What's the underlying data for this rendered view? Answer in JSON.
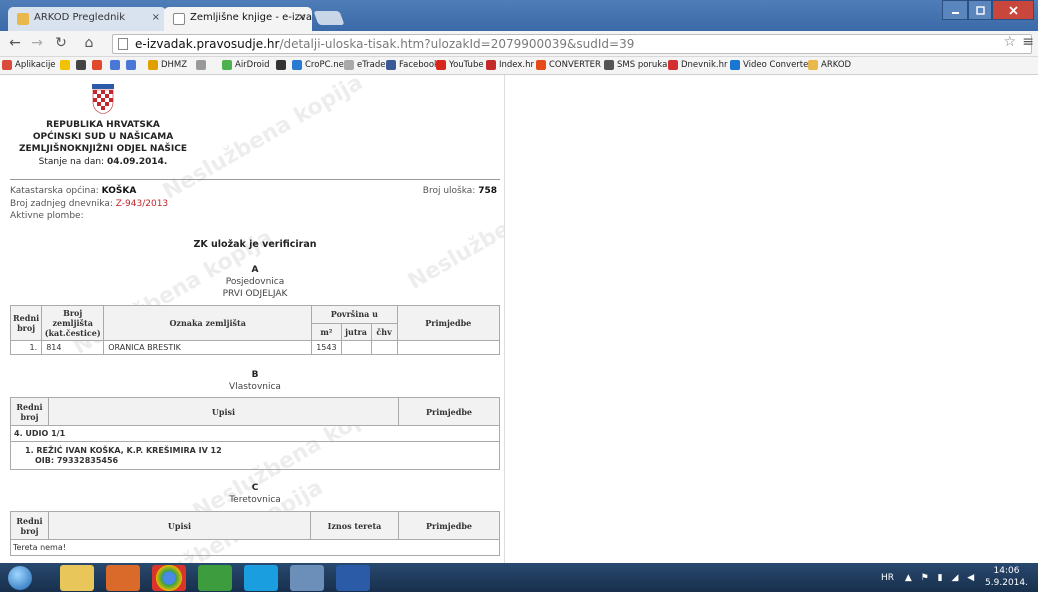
{
  "browser": {
    "tabs": [
      {
        "label": "ARKOD Preglednik"
      },
      {
        "label": "Zemljišne knjige - e-izvad"
      }
    ],
    "tab_close": "×",
    "url_host": "e-izvadak.pravosudje.hr",
    "url_path": "/detalji-uloska-tisak.htm?ulozakId=2079900039&sudId=39",
    "bookmarks": [
      {
        "label": "Aplikacije",
        "color": "#d94b3b"
      },
      {
        "label": "",
        "color": "#f2c200"
      },
      {
        "label": "",
        "color": "#444444"
      },
      {
        "label": "",
        "color": "#e04a2a"
      },
      {
        "label": "",
        "color": "#4a78d6"
      },
      {
        "label": "",
        "color": "#4a78d6"
      },
      {
        "label": "DHMZ",
        "color": "#e0a100"
      },
      {
        "label": "",
        "color": "#999999"
      },
      {
        "label": "AirDroid",
        "color": "#4db24d"
      },
      {
        "label": "",
        "color": "#333333"
      },
      {
        "label": "CroPC.net",
        "color": "#2a7ad1"
      },
      {
        "label": "eTrade",
        "color": "#aaaaaa"
      },
      {
        "label": "Facebook",
        "color": "#3b5998"
      },
      {
        "label": "YouTube",
        "color": "#d8261c"
      },
      {
        "label": "Index.hr",
        "color": "#c52a2a"
      },
      {
        "label": "CONVERTER",
        "color": "#e64a19"
      },
      {
        "label": "SMS poruka",
        "color": "#555555"
      },
      {
        "label": "Dnevnik.hr",
        "color": "#d32f2f"
      },
      {
        "label": "Video Converter",
        "color": "#1976d2"
      },
      {
        "label": "ARKOD",
        "color": "#e8b84a"
      }
    ]
  },
  "document": {
    "header": {
      "line1": "REPUBLIKA HRVATSKA",
      "line2": "OPĆINSKI SUD U NAŠICAMA",
      "line3": "ZEMLJIŠNOKNJIŽNI ODJEL NAŠICE",
      "date_label": "Stanje na dan:",
      "date_value": "04.09.2014."
    },
    "watermark": "Neslužbena kopija",
    "katastarska_label": "Katastarska općina:",
    "katastarska_value": "KOŠKA",
    "broj_uloska_label": "Broj uloška:",
    "broj_uloska_value": "758",
    "dnevnik_label": "Broj zadnjeg dnevnika:",
    "dnevnik_value": "Z-943/2013",
    "plombe_label": "Aktivne plombe:",
    "verified": "ZK uložak je verificiran",
    "section_a": {
      "letter": "A",
      "title": "Posjedovnica",
      "subtitle": "PRVI ODJELJAK"
    },
    "table_a": {
      "h_redni": "Redni broj",
      "h_broj": "Broj zemljišta (kat.čestice)",
      "h_oznaka": "Oznaka zemljišta",
      "h_povrsina": "Površina u",
      "h_m2": "m²",
      "h_jutra": "jutra",
      "h_chv": "čhv",
      "h_primjedbe": "Primjedbe",
      "row": {
        "redni": "1.",
        "broj": "814",
        "oznaka": "ORANICA BRESTIK",
        "m2": "1543"
      }
    },
    "section_b": {
      "letter": "B",
      "title": "Vlastovnica"
    },
    "table_b": {
      "h_redni": "Redni broj",
      "h_upisi": "Upisi",
      "h_primjedbe": "Primjedbe",
      "udio": "4. UDIO 1/1",
      "owner": "1. REŽIĆ IVAN KOŠKA, K.P. KREŠIMIRA IV 12",
      "oib": "OIB: 79332835456"
    },
    "section_c": {
      "letter": "C",
      "title": "Teretovnica"
    },
    "table_c": {
      "h_redni": "Redni broj",
      "h_upisi": "Upisi",
      "h_iznos": "Iznos tereta",
      "h_primjedbe": "Primjedbe",
      "empty": "Tereta nema!"
    }
  },
  "taskbar": {
    "lang": "HR",
    "time": "14:06",
    "date": "5.9.2014."
  }
}
